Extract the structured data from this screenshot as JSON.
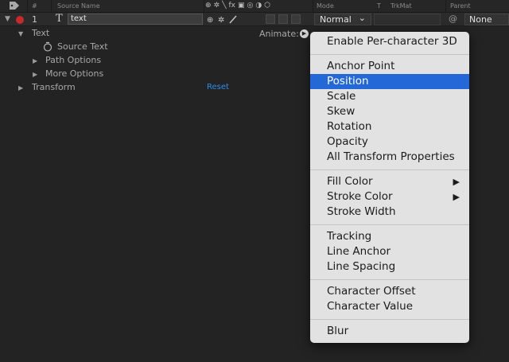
{
  "header": {
    "hash": "#",
    "source_name": "Source Name",
    "mode": "Mode",
    "t": "T",
    "trkmat": "TrkMat",
    "parent": "Parent",
    "switch_icons": [
      "⊕",
      "✲",
      "╲",
      "fx",
      "▣",
      "◎",
      "◑",
      "⬡"
    ]
  },
  "layer": {
    "twirl": "▼",
    "number": "1",
    "type_icon": "T",
    "name": "text",
    "mode": "Normal",
    "mode_chevron": "⌄",
    "parent": "None",
    "spiral": "@"
  },
  "properties": {
    "text_caret": "▼",
    "text_label": "Text",
    "animate_label": "Animate:",
    "animate_btn": "▶",
    "source_text": "Source Text",
    "stopwatch": "◌",
    "path_options": "Path Options",
    "more_options": "More Options",
    "collapsed_caret": "▶",
    "transform": "Transform",
    "reset": "Reset"
  },
  "menu": {
    "items": [
      "Enable Per-character 3D",
      "Anchor Point",
      "Position",
      "Scale",
      "Skew",
      "Rotation",
      "Opacity",
      "All Transform Properties",
      "Fill Color",
      "Stroke Color",
      "Stroke Width",
      "Tracking",
      "Line Anchor",
      "Line Spacing",
      "Character Offset",
      "Character Value",
      "Blur"
    ],
    "submenu_arrow": "▶",
    "selected": "Position"
  }
}
